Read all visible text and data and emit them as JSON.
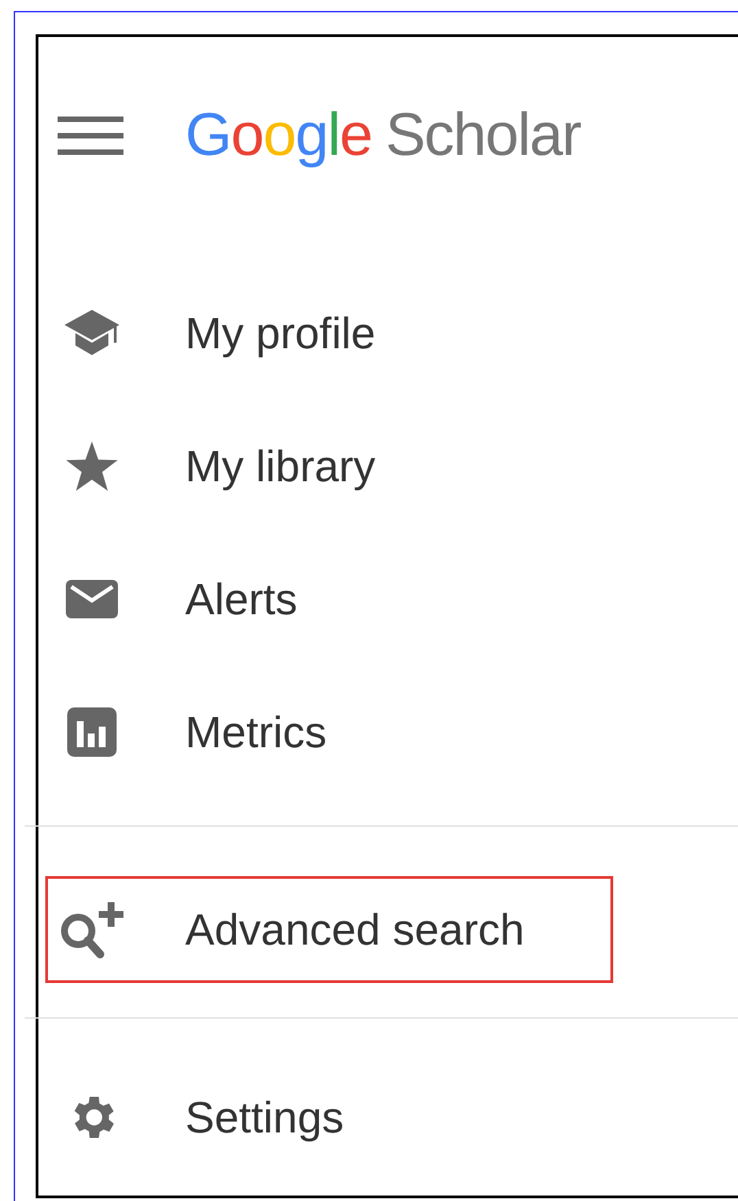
{
  "header": {
    "logo": {
      "letters": [
        {
          "text": "G",
          "color": "#4285f4"
        },
        {
          "text": "o",
          "color": "#ea4335"
        },
        {
          "text": "o",
          "color": "#fbbc05"
        },
        {
          "text": "g",
          "color": "#4285f4"
        },
        {
          "text": "l",
          "color": "#34a853"
        },
        {
          "text": "e",
          "color": "#ea4335"
        }
      ],
      "product": "Scholar"
    }
  },
  "menu": {
    "sections": [
      {
        "items": [
          {
            "kind": "profile",
            "label": "My profile",
            "highlighted": false
          },
          {
            "kind": "library",
            "label": "My library",
            "highlighted": false
          },
          {
            "kind": "alerts",
            "label": "Alerts",
            "highlighted": false
          },
          {
            "kind": "metrics",
            "label": "Metrics",
            "highlighted": false
          }
        ]
      },
      {
        "items": [
          {
            "kind": "advanced",
            "label": "Advanced search",
            "highlighted": true
          }
        ]
      },
      {
        "items": [
          {
            "kind": "settings",
            "label": "Settings",
            "highlighted": false
          }
        ]
      }
    ]
  }
}
